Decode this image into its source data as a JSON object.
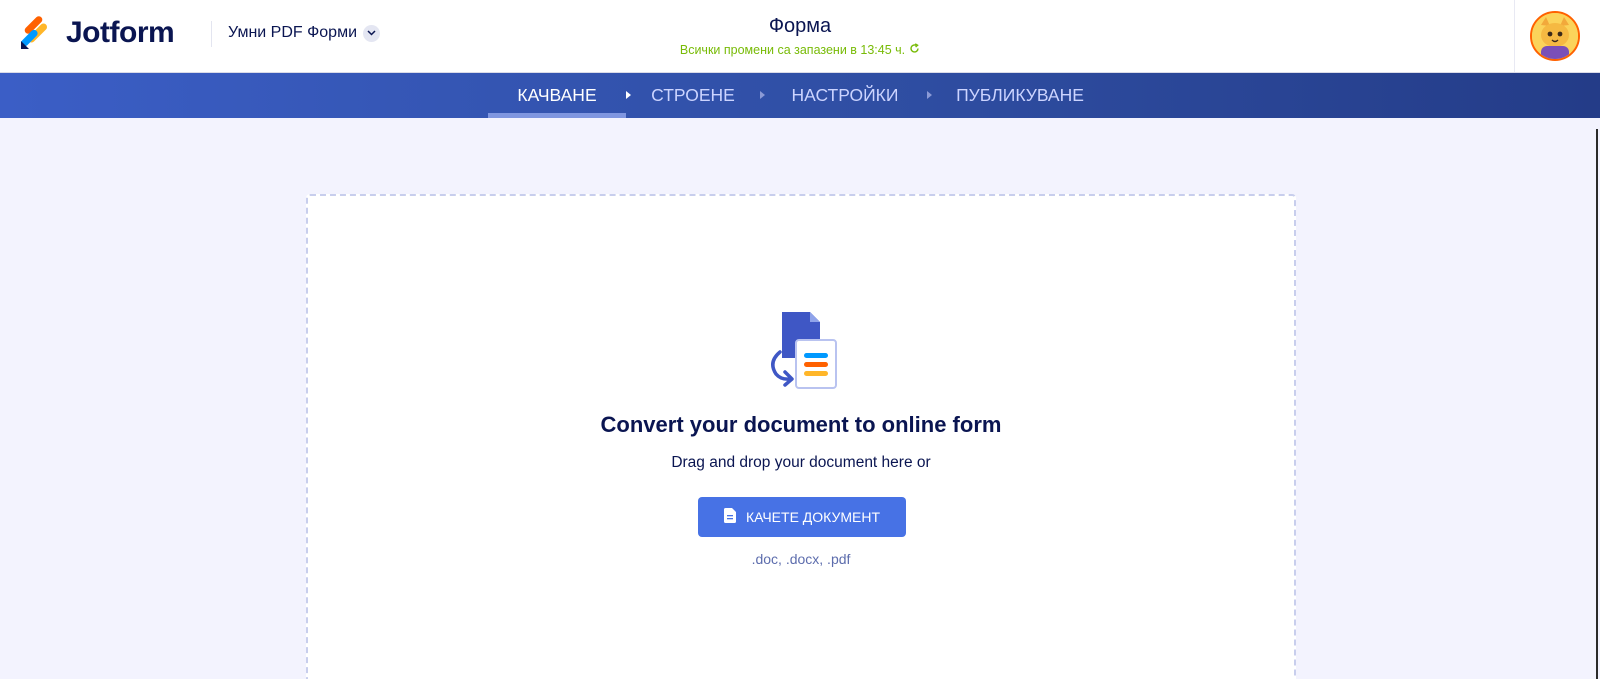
{
  "header": {
    "logo_text": "Jotform",
    "form_type_label": "Умни PDF Форми",
    "form_title": "Форма",
    "save_status": "Всички промени са запазени в 13:45 ч."
  },
  "steps": [
    {
      "label": "КАЧВАНЕ",
      "active": true
    },
    {
      "label": "СТРОЕНЕ",
      "active": false
    },
    {
      "label": "НАСТРОЙКИ",
      "active": false
    },
    {
      "label": "ПУБЛИКУВАНЕ",
      "active": false
    }
  ],
  "upload": {
    "heading": "Convert your document to online form",
    "subtext": "Drag and drop your document here or",
    "button_label": "КАЧЕТЕ ДОКУМЕНТ",
    "formats": ".doc, .docx, .pdf"
  },
  "icons": [
    "jotform-logo-icon",
    "chevron-down-icon",
    "refresh-icon",
    "avatar-icon",
    "document-convert-icon",
    "document-icon",
    "step-arrow-icon"
  ],
  "colors": {
    "brand_navy": "#0a1551",
    "save_green": "#78bb07",
    "nav_blue": "#3b5ec6",
    "button_blue": "#4772e5",
    "page_bg": "#f3f3fe"
  }
}
